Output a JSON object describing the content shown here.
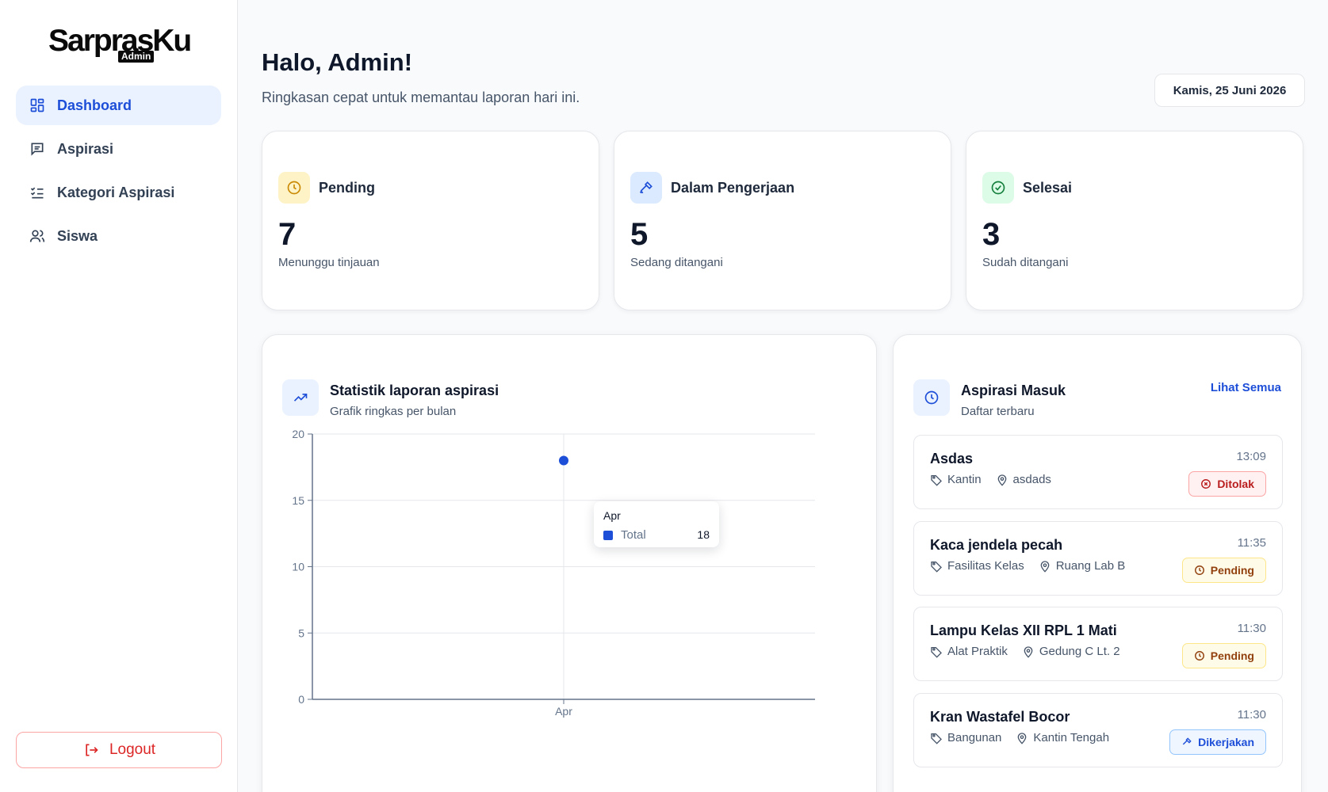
{
  "brand": {
    "name": "SarprasKu",
    "badge": "Admin"
  },
  "sidebar": {
    "items": [
      {
        "label": "Dashboard",
        "icon": "dashboard-icon",
        "active": true
      },
      {
        "label": "Aspirasi",
        "icon": "message-icon",
        "active": false
      },
      {
        "label": "Kategori Aspirasi",
        "icon": "list-check-icon",
        "active": false
      },
      {
        "label": "Siswa",
        "icon": "users-icon",
        "active": false
      }
    ],
    "logout_label": "Logout"
  },
  "header": {
    "greeting": "Halo, Admin!",
    "subtitle": "Ringkasan cepat untuk memantau laporan hari ini.",
    "date": "Kamis, 25 Juni 2026"
  },
  "stats": [
    {
      "title": "Pending",
      "value": "7",
      "desc": "Menunggu tinjauan",
      "icon": "clock-icon",
      "color": "#ca8a04",
      "bg": "#fef3c7"
    },
    {
      "title": "Dalam Pengerjaan",
      "value": "5",
      "desc": "Sedang ditangani",
      "icon": "hammer-icon",
      "color": "#1d4ed8",
      "bg": "#dbeafe"
    },
    {
      "title": "Selesai",
      "value": "3",
      "desc": "Sudah ditangani",
      "icon": "check-circle-icon",
      "color": "#15803d",
      "bg": "#dcfce7"
    }
  ],
  "chart_panel": {
    "title": "Statistik laporan aspirasi",
    "subtitle": "Grafik ringkas per bulan"
  },
  "chart_data": {
    "type": "line",
    "categories": [
      "Apr"
    ],
    "series": [
      {
        "name": "Total",
        "values": [
          18
        ],
        "color": "#1d4ed8"
      }
    ],
    "ylim": [
      0,
      20
    ],
    "yticks": [
      0,
      5,
      10,
      15,
      20
    ],
    "grid": true,
    "tooltip": {
      "title": "Apr",
      "label": "Total",
      "value": "18"
    }
  },
  "aspirasi_panel": {
    "title": "Aspirasi Masuk",
    "subtitle": "Daftar terbaru",
    "see_all": "Lihat Semua",
    "items": [
      {
        "title": "Asdas",
        "category": "Kantin",
        "location": "asdads",
        "time": "13:09",
        "status": "Ditolak",
        "status_type": "ditolak"
      },
      {
        "title": "Kaca jendela pecah",
        "category": "Fasilitas Kelas",
        "location": "Ruang Lab B",
        "time": "11:35",
        "status": "Pending",
        "status_type": "pending"
      },
      {
        "title": "Lampu Kelas XII RPL 1 Mati",
        "category": "Alat Praktik",
        "location": "Gedung C Lt. 2",
        "time": "11:30",
        "status": "Pending",
        "status_type": "pending"
      },
      {
        "title": "Kran Wastafel Bocor",
        "category": "Bangunan",
        "location": "Kantin Tengah",
        "time": "11:30",
        "status": "Dikerjakan",
        "status_type": "dikerjakan"
      }
    ]
  }
}
